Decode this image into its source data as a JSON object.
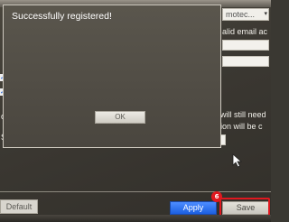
{
  "dialog": {
    "title": "Successfully registered!",
    "ok_label": "OK"
  },
  "background": {
    "dropdown_value": "motec...",
    "dropdown_arrow": "▾",
    "text_email": "alid email ac",
    "text_still_need": "will still need",
    "text_ion_will": "ion will be c",
    "left_marks": [
      "o",
      "S"
    ]
  },
  "footer": {
    "default_label": "Default",
    "apply_label": "Apply",
    "save_label": "Save",
    "step_badge": "6"
  },
  "colors": {
    "accent": "#1c5fe0",
    "highlight": "#e0181f"
  }
}
